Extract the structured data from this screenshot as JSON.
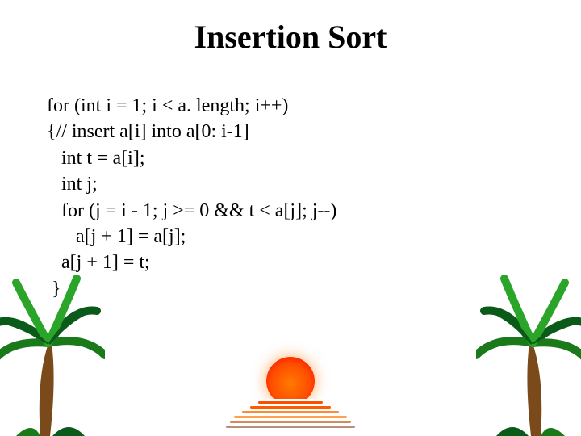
{
  "title": "Insertion Sort",
  "code_lines": [
    "for (int i = 1; i < a. length; i++)",
    "{// insert a[i] into a[0: i-1]",
    "   int t = a[i];",
    "   int j;",
    "   for (j = i - 1; j >= 0 && t < a[j]; j--)",
    "      a[j + 1] = a[j];",
    "   a[j + 1] = t;",
    " }"
  ],
  "decor": {
    "sunset_icon": "sunset-icon",
    "palm_left": "palm-tree-left-icon",
    "palm_right": "palm-tree-right-icon"
  },
  "colors": {
    "sun_core": "#ff7a00",
    "sun_edge": "#ff1e00",
    "trunk": "#7a4a1a",
    "frond_dark": "#0a5a1a",
    "frond_light": "#2aa52a"
  }
}
